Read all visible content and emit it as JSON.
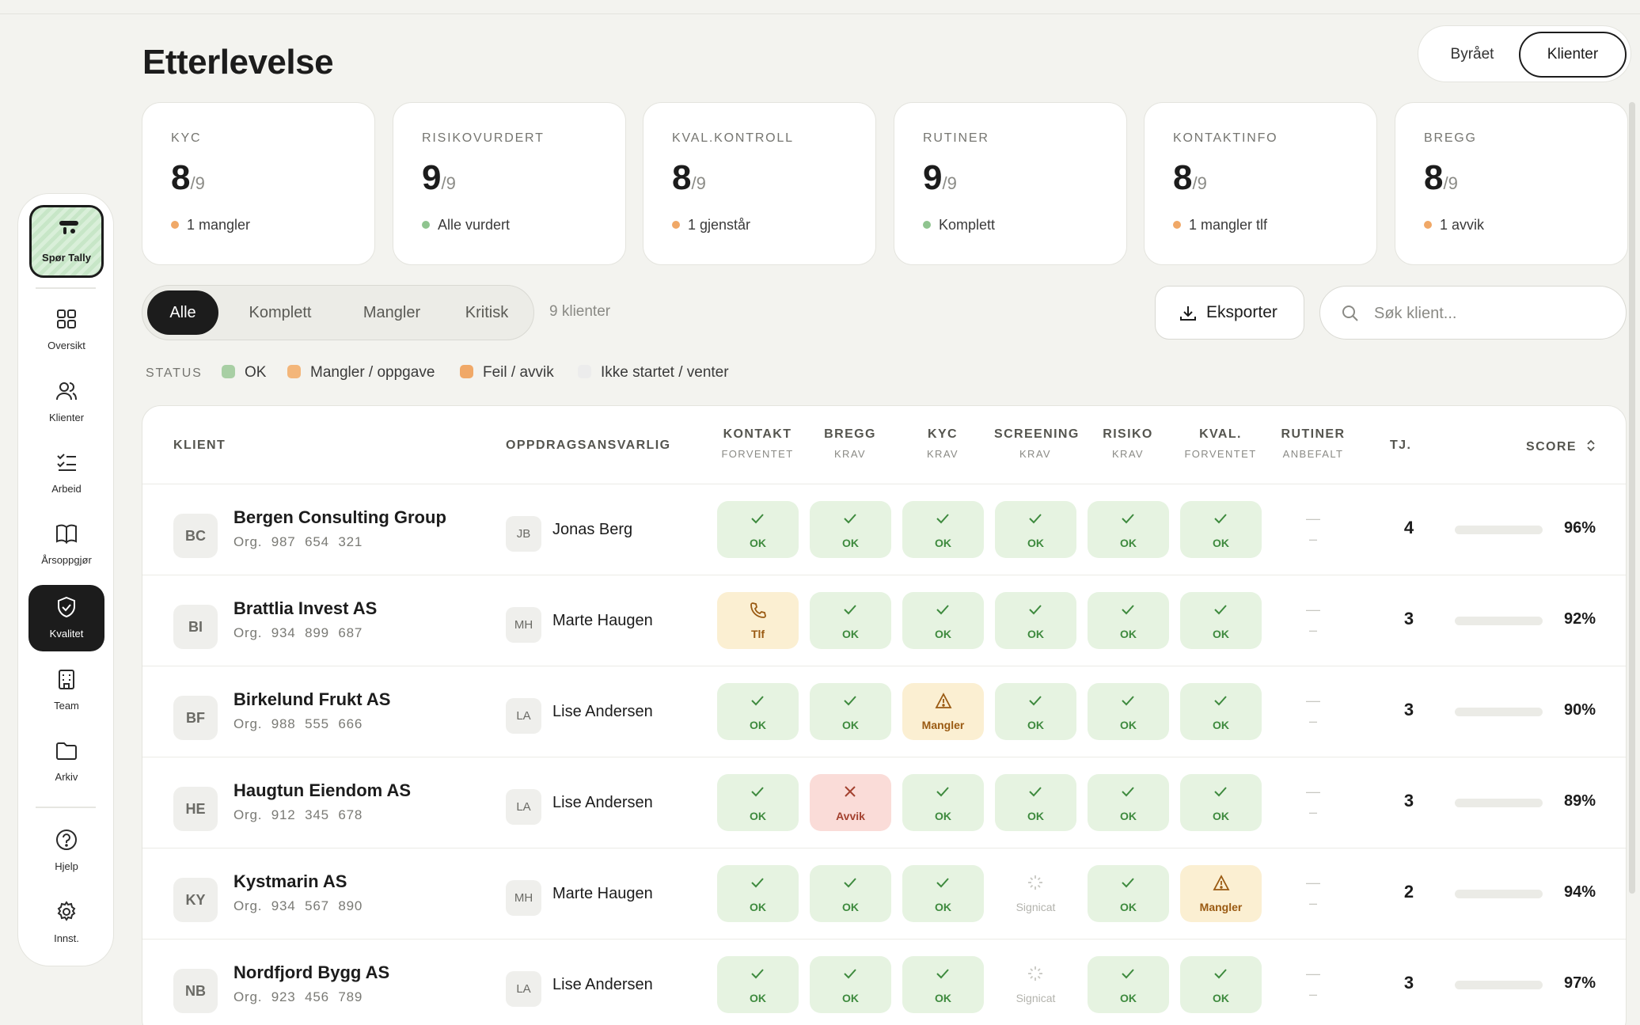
{
  "page_title": "Etterlevelse",
  "view_toggle": {
    "option1": "Byrået",
    "option2": "Klienter"
  },
  "sidebar": {
    "ask_tally": "Spør Tally",
    "items": [
      "Oversikt",
      "Klienter",
      "Arbeid",
      "Årsoppgjør",
      "Kvalitet",
      "Team",
      "Arkiv",
      "Hjelp",
      "Innst."
    ]
  },
  "stats": [
    {
      "label": "KYC",
      "value": "8",
      "denominator": "/9",
      "note": "1 mangler",
      "dot": "#f0a867"
    },
    {
      "label": "RISIKOVURDERT",
      "value": "9",
      "denominator": "/9",
      "note": "Alle vurdert",
      "dot": "#8fc48f"
    },
    {
      "label": "KVAL.KONTROLL",
      "value": "8",
      "denominator": "/9",
      "note": "1 gjenstår",
      "dot": "#f0a867"
    },
    {
      "label": "RUTINER",
      "value": "9",
      "denominator": "/9",
      "note": "Komplett",
      "dot": "#8fc48f"
    },
    {
      "label": "KONTAKTINFO",
      "value": "8",
      "denominator": "/9",
      "note": "1 mangler tlf",
      "dot": "#f0a867"
    },
    {
      "label": "BREGG",
      "value": "8",
      "denominator": "/9",
      "note": "1 avvik",
      "dot": "#f0a867"
    }
  ],
  "filters": {
    "tabs": [
      "Alle",
      "Komplett",
      "Mangler",
      "Kritisk"
    ],
    "count": "9 klienter"
  },
  "export_label": "Eksporter",
  "search_placeholder": "Søk klient...",
  "legend": {
    "title": "STATUS",
    "items": [
      {
        "label": "OK",
        "color": "#a8cfa4"
      },
      {
        "label": "Mangler / oppgave",
        "color": "#f3b67a"
      },
      {
        "label": "Feil / avvik",
        "color": "#f0a867"
      },
      {
        "label": "Ikke startet / venter",
        "color": "#ececec"
      }
    ]
  },
  "table": {
    "headers": {
      "client": "KLIENT",
      "responsible": "OPPDRAGSANSVARLIG",
      "columns": [
        {
          "top": "KONTAKT",
          "sub": "FORVENTET"
        },
        {
          "top": "BREGG",
          "sub": "KRAV"
        },
        {
          "top": "KYC",
          "sub": "KRAV"
        },
        {
          "top": "SCREENING",
          "sub": "KRAV"
        },
        {
          "top": "RISIKO",
          "sub": "KRAV"
        },
        {
          "top": "KVAL.",
          "sub": "FORVENTET"
        },
        {
          "top": "RUTINER",
          "sub": "ANBEFALT"
        }
      ],
      "tj": "TJ.",
      "score": "SCORE"
    },
    "rows": [
      {
        "initials": "BC",
        "name": "Bergen Consulting Group",
        "org_prefix": "Org.",
        "org": "987 654 321",
        "resp_initials": "JB",
        "resp": "Jonas Berg",
        "tj": "4",
        "score": "96%",
        "score_value": 96,
        "cells": [
          [
            "ok",
            "OK"
          ],
          [
            "ok",
            "OK"
          ],
          [
            "ok",
            "OK"
          ],
          [
            "ok",
            "OK"
          ],
          [
            "ok",
            "OK"
          ],
          [
            "ok",
            "OK"
          ]
        ]
      },
      {
        "initials": "BI",
        "name": "Brattlia Invest AS",
        "org_prefix": "Org.",
        "org": "934 899 687",
        "resp_initials": "MH",
        "resp": "Marte Haugen",
        "tj": "3",
        "score": "92%",
        "score_value": 92,
        "cells": [
          [
            "phone",
            "Tlf"
          ],
          [
            "ok",
            "OK"
          ],
          [
            "ok",
            "OK"
          ],
          [
            "ok",
            "OK"
          ],
          [
            "ok",
            "OK"
          ],
          [
            "ok",
            "OK"
          ]
        ]
      },
      {
        "initials": "BF",
        "name": "Birkelund Frukt AS",
        "org_prefix": "Org.",
        "org": "988 555 666",
        "resp_initials": "LA",
        "resp": "Lise Andersen",
        "tj": "3",
        "score": "90%",
        "score_value": 90,
        "cells": [
          [
            "ok",
            "OK"
          ],
          [
            "ok",
            "OK"
          ],
          [
            "warn",
            "Mangler"
          ],
          [
            "ok",
            "OK"
          ],
          [
            "ok",
            "OK"
          ],
          [
            "ok",
            "OK"
          ]
        ]
      },
      {
        "initials": "HE",
        "name": "Haugtun Eiendom AS",
        "org_prefix": "Org.",
        "org": "912 345 678",
        "resp_initials": "LA",
        "resp": "Lise Andersen",
        "tj": "3",
        "score": "89%",
        "score_value": 89,
        "cells": [
          [
            "ok",
            "OK"
          ],
          [
            "err",
            "Avvik"
          ],
          [
            "ok",
            "OK"
          ],
          [
            "ok",
            "OK"
          ],
          [
            "ok",
            "OK"
          ],
          [
            "ok",
            "OK"
          ]
        ]
      },
      {
        "initials": "KY",
        "name": "Kystmarin AS",
        "org_prefix": "Org.",
        "org": "934 567 890",
        "resp_initials": "MH",
        "resp": "Marte Haugen",
        "tj": "2",
        "score": "94%",
        "score_value": 94,
        "cells": [
          [
            "ok",
            "OK"
          ],
          [
            "ok",
            "OK"
          ],
          [
            "ok",
            "OK"
          ],
          [
            "pend",
            "Signicat"
          ],
          [
            "ok",
            "OK"
          ],
          [
            "warn",
            "Mangler"
          ]
        ]
      },
      {
        "initials": "NB",
        "name": "Nordfjord Bygg AS",
        "org_prefix": "Org.",
        "org": "923 456 789",
        "resp_initials": "LA",
        "resp": "Lise Andersen",
        "tj": "3",
        "score": "97%",
        "score_value": 97,
        "cells": [
          [
            "ok",
            "OK"
          ],
          [
            "ok",
            "OK"
          ],
          [
            "ok",
            "OK"
          ],
          [
            "pend",
            "Signicat"
          ],
          [
            "ok",
            "OK"
          ],
          [
            "ok",
            "OK"
          ]
        ]
      }
    ],
    "rutiner_dash_top": "—",
    "rutiner_dash_bottom": "–"
  }
}
